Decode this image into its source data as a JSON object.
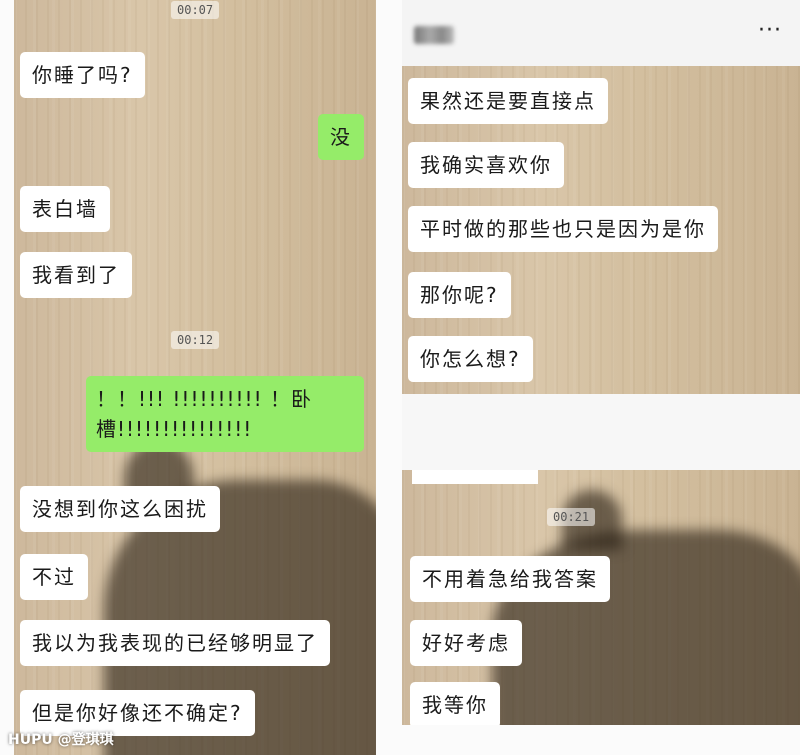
{
  "left_chat": {
    "timestamps": [
      "00:07",
      "00:12"
    ],
    "messages": [
      {
        "side": "in",
        "text": "你睡了吗?"
      },
      {
        "side": "out",
        "text": "没"
      },
      {
        "side": "in",
        "text": "表白墙"
      },
      {
        "side": "in",
        "text": "我看到了"
      },
      {
        "side": "out",
        "line1": "！！!!! !!!!!!!!!! ！卧",
        "line2": "槽!!!!!!!!!!!!!!!"
      },
      {
        "side": "in",
        "text": "没想到你这么困扰"
      },
      {
        "side": "in",
        "text": "不过"
      },
      {
        "side": "in",
        "text": "我以为我表现的已经够明显了"
      },
      {
        "side": "in",
        "text": "但是你好像还不确定?"
      }
    ]
  },
  "right_chat": {
    "header": {
      "more_icon": "more-icon",
      "more_glyph": "···"
    },
    "top_messages": [
      {
        "side": "in",
        "text": "果然还是要直接点"
      },
      {
        "side": "in",
        "text": "我确实喜欢你"
      },
      {
        "side": "in",
        "text": "平时做的那些也只是因为是你"
      },
      {
        "side": "in",
        "text": "那你呢?"
      },
      {
        "side": "in",
        "text": "你怎么想?"
      }
    ],
    "timestamp": "00:21",
    "bottom_messages": [
      {
        "side": "in",
        "text": "不用着急给我答案"
      },
      {
        "side": "in",
        "text": "好好考虑"
      },
      {
        "side": "in",
        "text": "我等你"
      }
    ]
  },
  "watermark": "HUPU @登琪琪",
  "colors": {
    "incoming": "#ffffff",
    "outgoing": "#95ec69"
  }
}
